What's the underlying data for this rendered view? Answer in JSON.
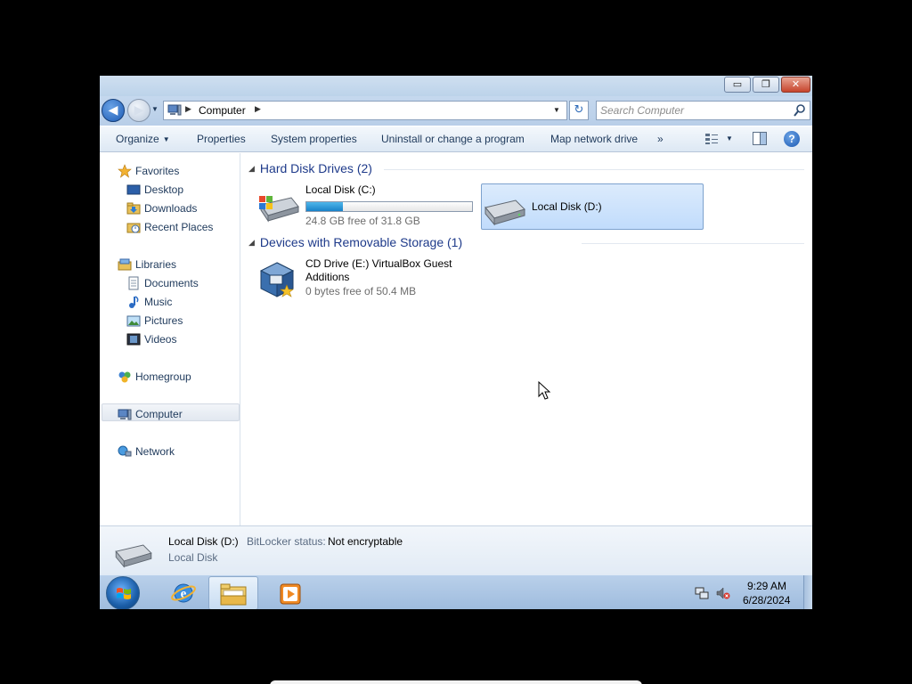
{
  "window": {
    "caption_buttons": {
      "minimize": "▭",
      "maximize": "❐",
      "close": "✕"
    }
  },
  "address_bar": {
    "back_glyph": "◀",
    "forward_glyph": "▶",
    "dropdown_glyph": "▼",
    "separator_glyph": "▶",
    "location": "Computer",
    "refresh_glyph": "↻",
    "search_placeholder": "Search Computer"
  },
  "toolbar": {
    "organize": "Organize",
    "dropdown_glyph": "▼",
    "properties": "Properties",
    "system_properties": "System properties",
    "uninstall": "Uninstall or change a program",
    "map_network_drive": "Map network drive",
    "more": "»",
    "help": "?"
  },
  "sidebar": {
    "favorites": "Favorites",
    "desktop": "Desktop",
    "downloads": "Downloads",
    "recent_places": "Recent Places",
    "libraries": "Libraries",
    "documents": "Documents",
    "music": "Music",
    "pictures": "Pictures",
    "videos": "Videos",
    "homegroup": "Homegroup",
    "computer": "Computer",
    "network": "Network"
  },
  "content": {
    "collapse_glyph": "◢",
    "hard_disk_header": "Hard Disk Drives (2)",
    "disk_c": {
      "name": "Local Disk (C:)",
      "free": "24.8 GB free of 31.8 GB",
      "used_fraction": 0.22
    },
    "disk_d": {
      "name": "Local Disk (D:)"
    },
    "removable_header": "Devices with Removable Storage (1)",
    "cd_drive": {
      "name_line1": "CD Drive (E:) VirtualBox Guest",
      "name_line2": "Additions",
      "free": "0 bytes free of 50.4 MB"
    }
  },
  "details": {
    "name": "Local Disk (D:)",
    "bitlocker_label": "BitLocker status:",
    "bitlocker_value": "Not encryptable",
    "type": "Local Disk"
  },
  "taskbar": {
    "time": "9:29 AM",
    "date": "6/28/2024"
  },
  "colors": {
    "accent": "#1e395b",
    "selection": "#c1dcfc",
    "progress": "#1882c8"
  }
}
